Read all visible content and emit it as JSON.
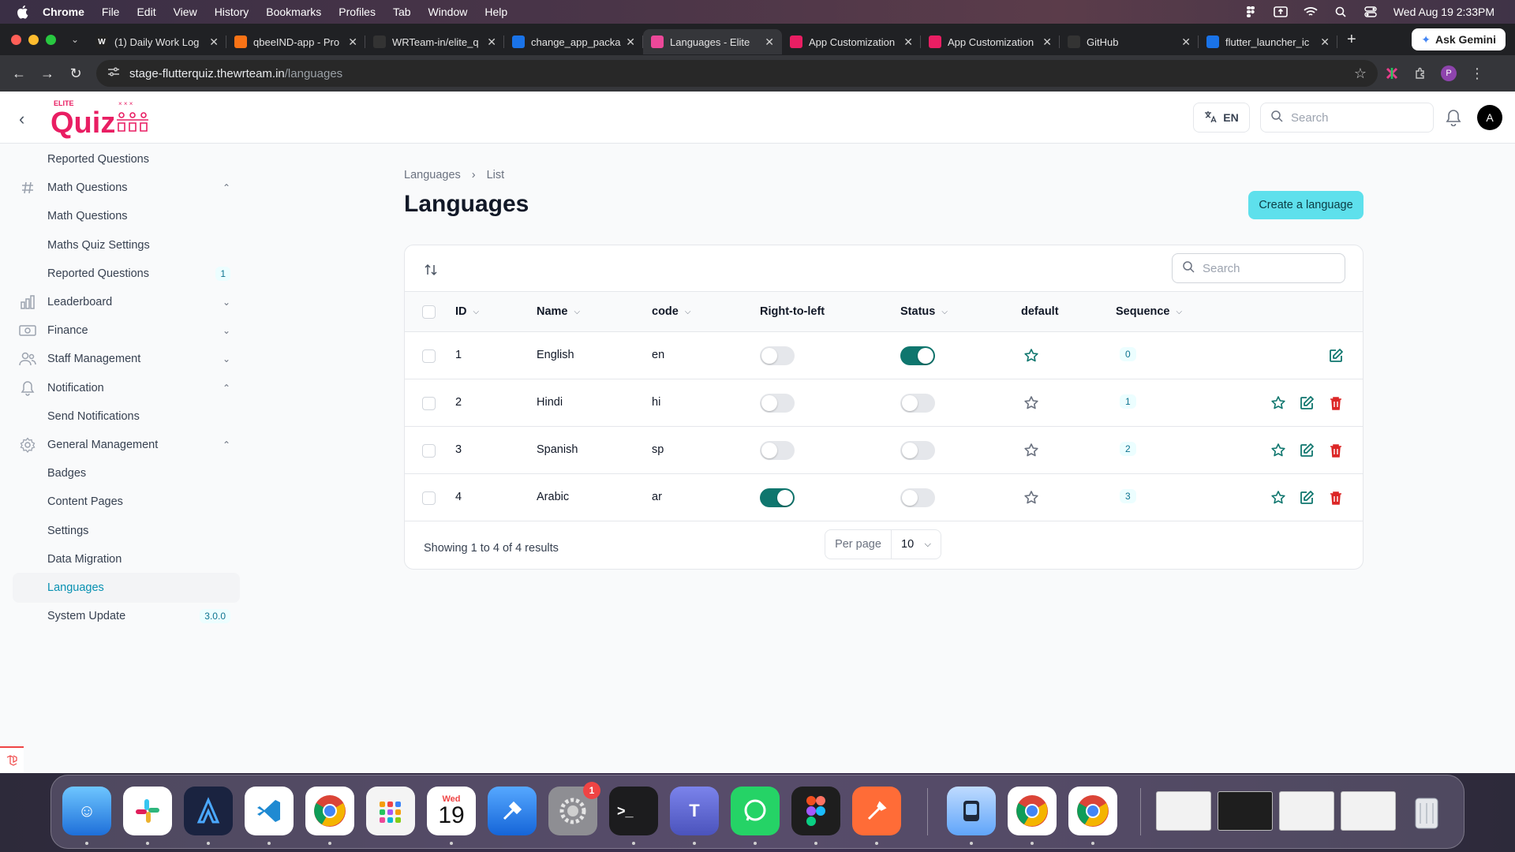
{
  "menubar": {
    "app": "Chrome",
    "items": [
      "File",
      "Edit",
      "View",
      "History",
      "Bookmarks",
      "Profiles",
      "Tab",
      "Window",
      "Help"
    ],
    "datetime": "Wed Aug 19  2:33PM"
  },
  "tabs": [
    {
      "label": "(1) Daily Work Log",
      "fav": "W",
      "color": "#222222"
    },
    {
      "label": "qbeeIND-app - Pro",
      "fav": "",
      "color": "#f97316"
    },
    {
      "label": "WRTeam-in/elite_q",
      "fav": "",
      "color": "#333333"
    },
    {
      "label": "change_app_packa",
      "fav": "",
      "color": "#1a73e8"
    },
    {
      "label": "Languages - Elite",
      "fav": "",
      "color": "#ec4899",
      "active": true
    },
    {
      "label": "App Customization",
      "fav": "",
      "color": "#e91e63"
    },
    {
      "label": "App Customization",
      "fav": "",
      "color": "#e91e63"
    },
    {
      "label": "GitHub",
      "fav": "",
      "color": "#333333"
    },
    {
      "label": "flutter_launcher_ic",
      "fav": "",
      "color": "#1a73e8"
    }
  ],
  "gemini_label": "Ask Gemini",
  "url": {
    "host": "stage-flutterquiz.thewrteam.in",
    "path": "/languages"
  },
  "profile_initial": "P",
  "header": {
    "logo_small": "ELITE",
    "logo_text": "Quiz",
    "lang": "EN",
    "search_placeholder": "Search",
    "avatar": "A"
  },
  "sidebar": {
    "items": [
      {
        "label": "Reported Questions",
        "type": "sub"
      },
      {
        "label": "Math Questions",
        "type": "group",
        "icon": "hash-icon",
        "chevron": "up"
      },
      {
        "label": "Math Questions",
        "type": "sub"
      },
      {
        "label": "Maths Quiz Settings",
        "type": "sub"
      },
      {
        "label": "Reported Questions",
        "type": "sub",
        "badge": "1"
      },
      {
        "label": "Leaderboard",
        "type": "group",
        "icon": "chart-icon",
        "chevron": "down"
      },
      {
        "label": "Finance",
        "type": "group",
        "icon": "cash-icon",
        "chevron": "down"
      },
      {
        "label": "Staff Management",
        "type": "group",
        "icon": "users-icon",
        "chevron": "down"
      },
      {
        "label": "Notification",
        "type": "group",
        "icon": "bell-icon",
        "chevron": "up"
      },
      {
        "label": "Send Notifications",
        "type": "sub"
      },
      {
        "label": "General Management",
        "type": "group",
        "icon": "gear-icon",
        "chevron": "up"
      },
      {
        "label": "Badges",
        "type": "sub"
      },
      {
        "label": "Content Pages",
        "type": "sub"
      },
      {
        "label": "Settings",
        "type": "sub"
      },
      {
        "label": "Data Migration",
        "type": "sub"
      },
      {
        "label": "Languages",
        "type": "sub",
        "active": true
      },
      {
        "label": "System Update",
        "type": "sub",
        "badge": "3.0.0"
      }
    ]
  },
  "breadcrumb": {
    "parent": "Languages",
    "current": "List"
  },
  "page": {
    "title": "Languages",
    "create_label": "Create a language"
  },
  "table": {
    "search_placeholder": "Search",
    "columns": [
      "ID",
      "Name",
      "code",
      "Right-to-left",
      "Status",
      "default",
      "Sequence"
    ],
    "rows": [
      {
        "id": "1",
        "name": "English",
        "code": "en",
        "rtl": false,
        "status": true,
        "seq": "0",
        "is_default": true
      },
      {
        "id": "2",
        "name": "Hindi",
        "code": "hi",
        "rtl": false,
        "status": false,
        "seq": "1",
        "is_default": false
      },
      {
        "id": "3",
        "name": "Spanish",
        "code": "sp",
        "rtl": false,
        "status": false,
        "seq": "2",
        "is_default": false
      },
      {
        "id": "4",
        "name": "Arabic",
        "code": "ar",
        "rtl": true,
        "status": false,
        "seq": "3",
        "is_default": false
      }
    ],
    "footer": "Showing 1 to 4 of 4 results",
    "per_page_label": "Per page",
    "per_page_value": "10"
  },
  "colors": {
    "accent": "#0891b2",
    "toggle_on": "#0f766e",
    "danger": "#dc2626",
    "create_btn": "#5ee0ec"
  },
  "dock": {
    "calendar_day": "Wed",
    "calendar_date": "19",
    "settings_badge": "1"
  }
}
